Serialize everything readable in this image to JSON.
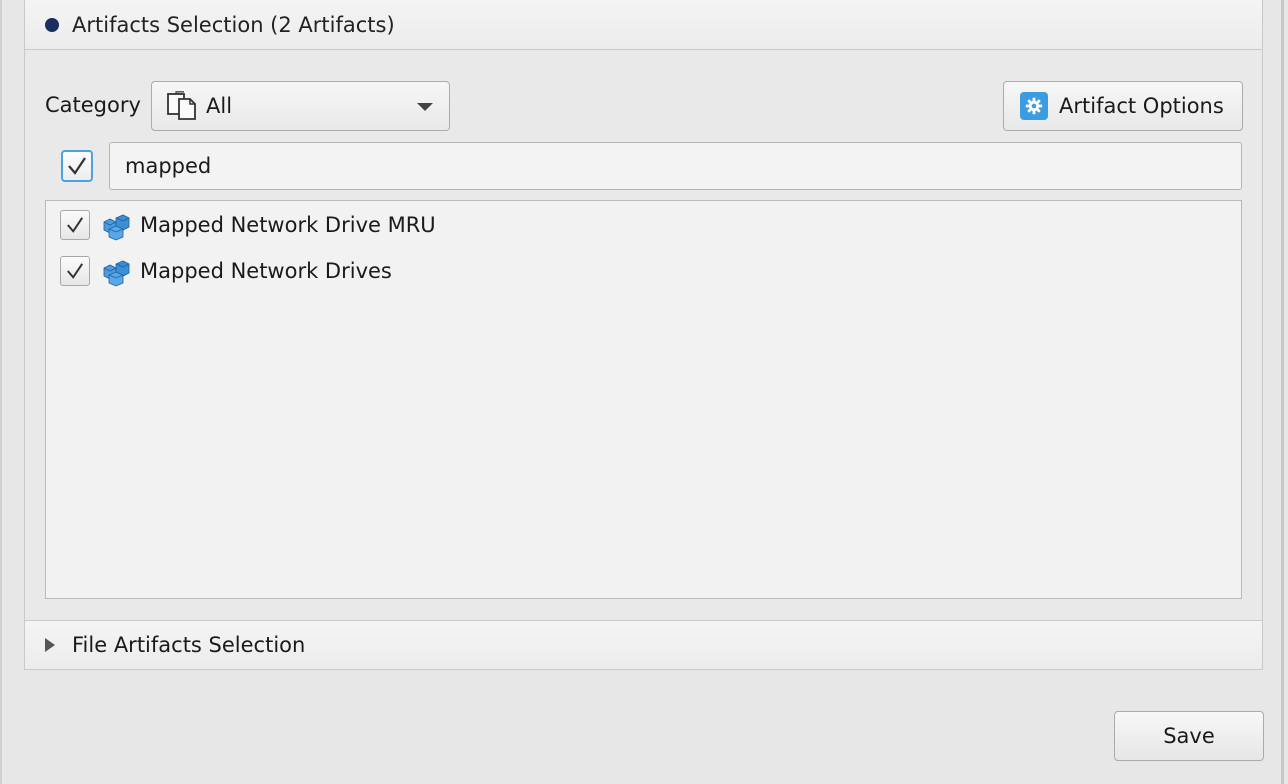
{
  "artifacts_panel": {
    "title": "Artifacts Selection (2 Artifacts)",
    "category_label": "Category",
    "category_value": "All",
    "options_label": "Artifact Options",
    "filter_checked": true,
    "search_value": "mapped",
    "items": [
      {
        "label": "Mapped Network Drive MRU",
        "checked": true,
        "icon": "registry-cubes-icon"
      },
      {
        "label": "Mapped Network Drives",
        "checked": true,
        "icon": "registry-cubes-icon"
      }
    ]
  },
  "file_panel": {
    "title": "File Artifacts Selection",
    "expanded": false
  },
  "footer": {
    "save_label": "Save"
  },
  "colors": {
    "bullet": "#1b2f5e",
    "gear_box": "#3d9be0",
    "focus_border": "#4aa3df",
    "item_icon": "#3b8fd6"
  }
}
